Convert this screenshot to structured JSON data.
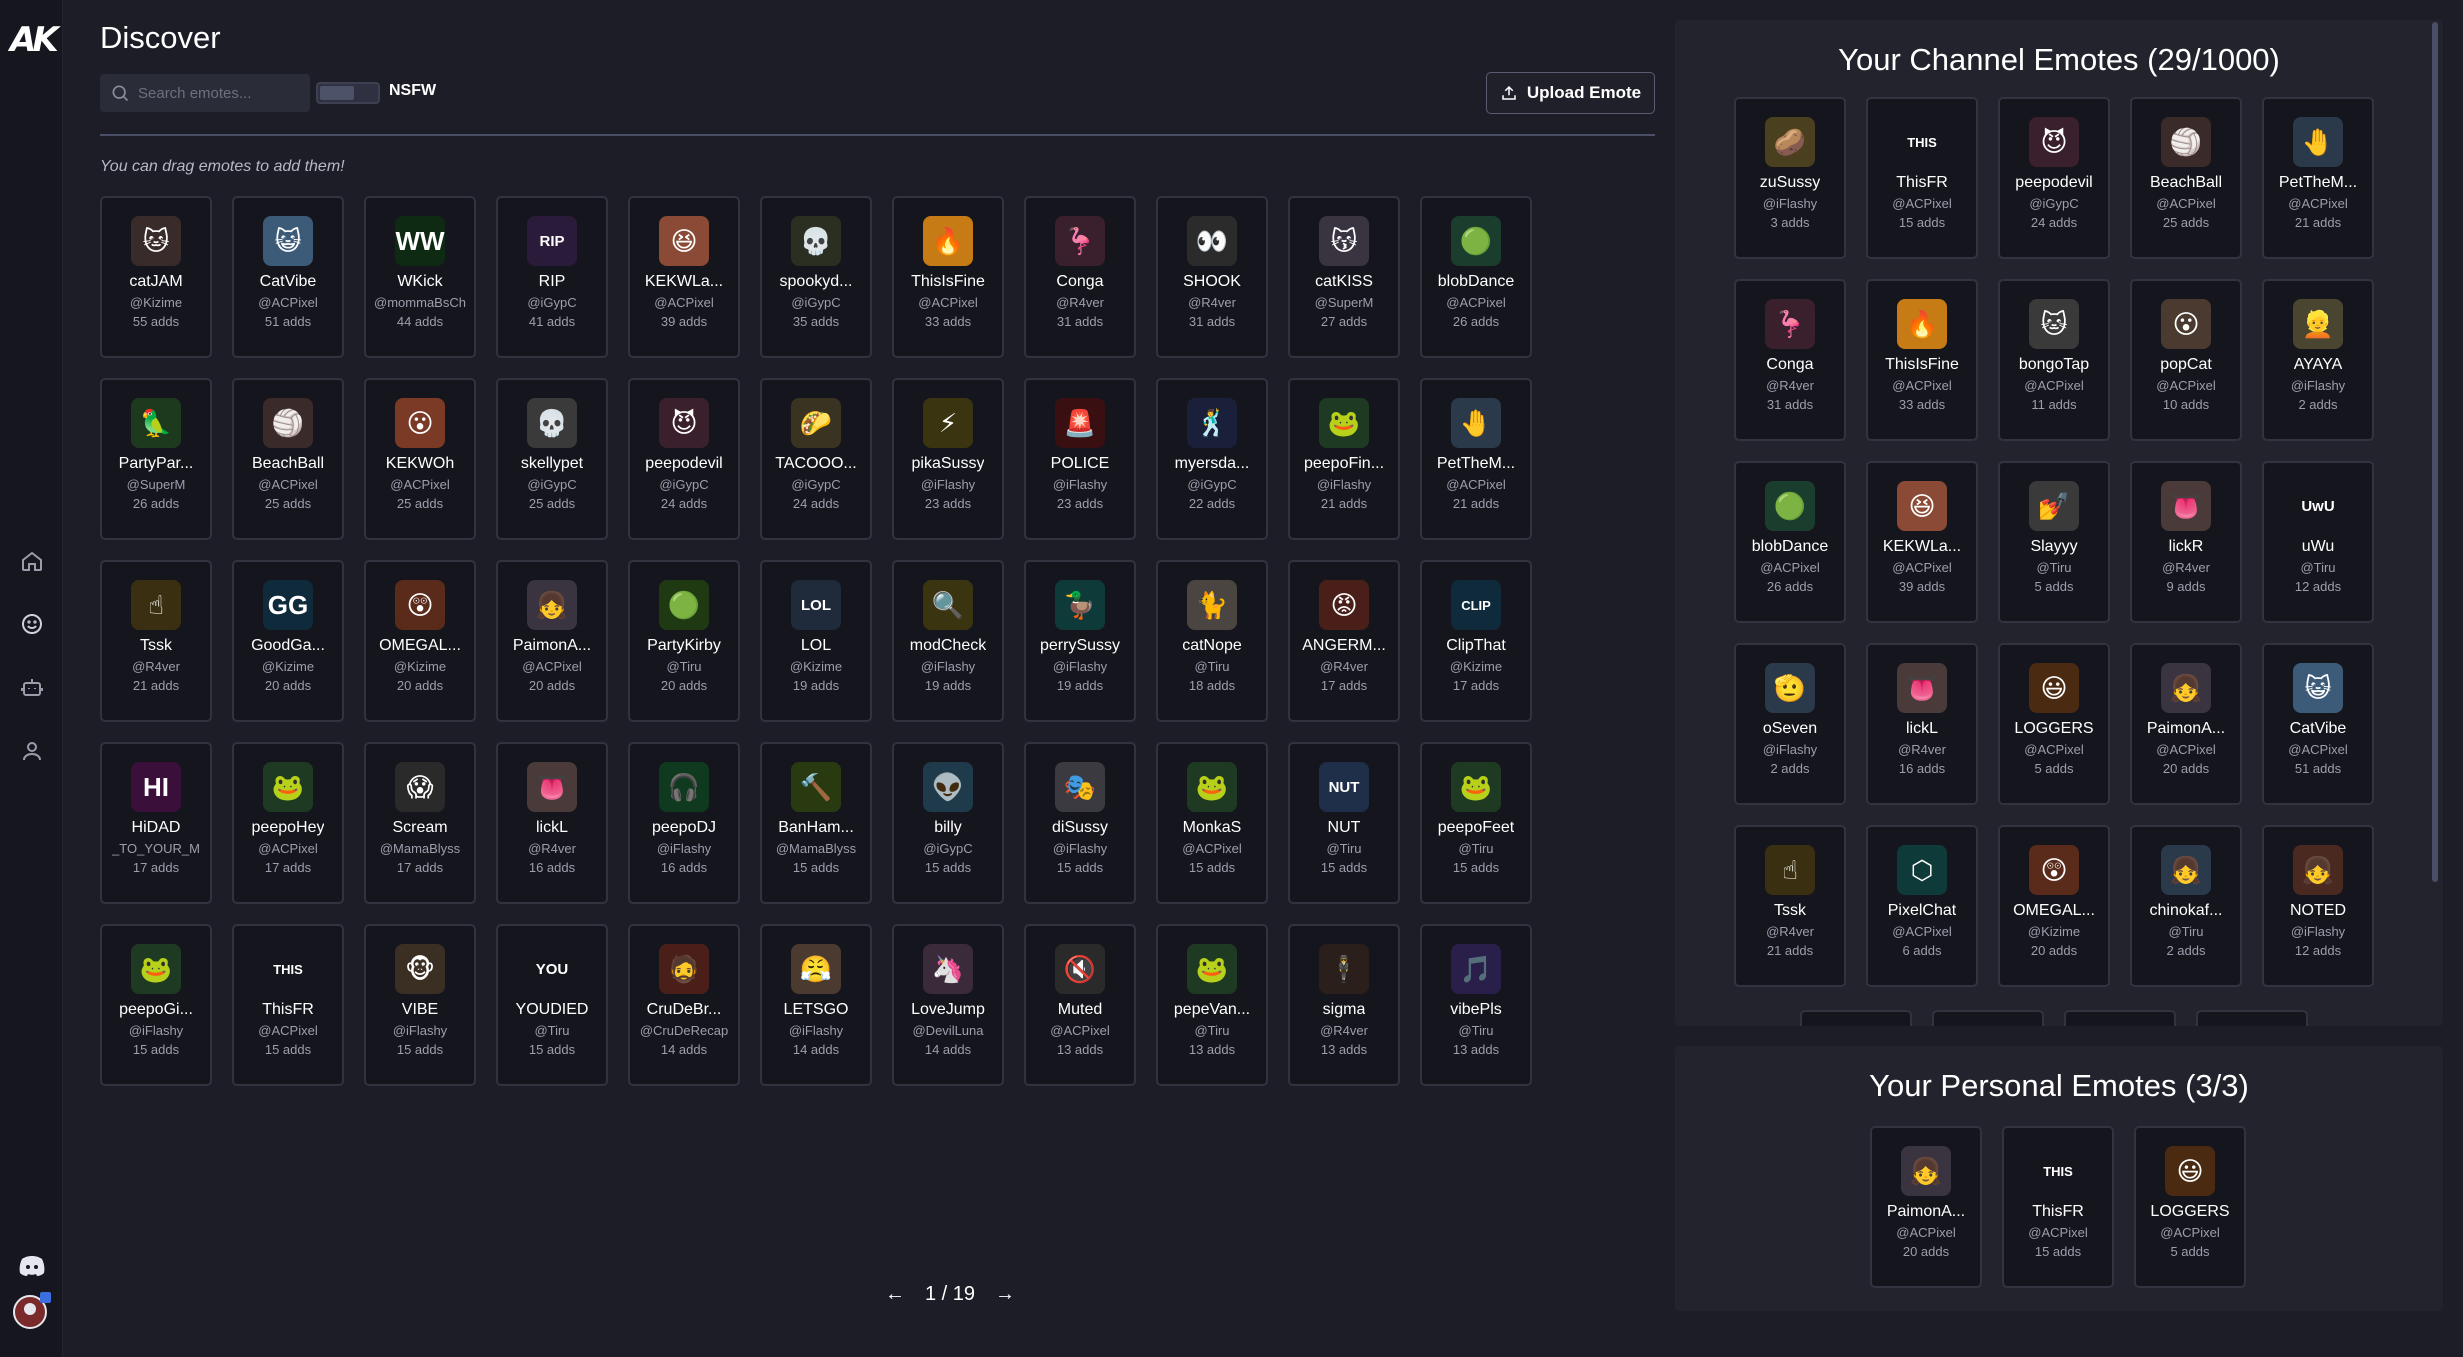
{
  "app": {
    "logo_text": "AK",
    "colors": {
      "background": "#1c1d26",
      "sidebar": "#16171e",
      "card": "#15161d",
      "panel": "#22232d",
      "divider": "#4b4f66"
    }
  },
  "sidebar": {
    "items": [
      {
        "name": "home",
        "icon": "home-icon"
      },
      {
        "name": "emotes",
        "icon": "smiley-icon"
      },
      {
        "name": "bot",
        "icon": "bot-icon"
      },
      {
        "name": "profile",
        "icon": "user-icon"
      }
    ],
    "bottom": [
      {
        "name": "discord",
        "icon": "discord-icon"
      },
      {
        "name": "avatar",
        "icon": "avatar-icon"
      }
    ]
  },
  "discover": {
    "title": "Discover",
    "search_placeholder": "Search emotes...",
    "nsfw_label": "NSFW",
    "nsfw_enabled": false,
    "upload_label": "Upload Emote",
    "hint": "You can drag emotes to add them!",
    "emotes": [
      {
        "name": "catJAM",
        "owner": "@Kizime",
        "adds": "55 adds",
        "glyph": "🐱",
        "color": "#3a2b2b"
      },
      {
        "name": "CatVibe",
        "owner": "@ACPixel",
        "adds": "51 adds",
        "glyph": "😺",
        "color": "#3b5b78"
      },
      {
        "name": "WKick",
        "owner": "@mommaBsCh",
        "adds": "44 adds",
        "glyph": "WW",
        "color": "#0f2a12"
      },
      {
        "name": "RIP",
        "owner": "@iGypC",
        "adds": "41 adds",
        "glyph": "RIP",
        "color": "#2b1b3a"
      },
      {
        "name": "KEKWLa...",
        "owner": "@ACPixel",
        "adds": "39 adds",
        "glyph": "😆",
        "color": "#8a4a35"
      },
      {
        "name": "spookyd...",
        "owner": "@iGypC",
        "adds": "35 adds",
        "glyph": "💀",
        "color": "#2b2f22"
      },
      {
        "name": "ThisIsFine",
        "owner": "@ACPixel",
        "adds": "33 adds",
        "glyph": "🔥",
        "color": "#c77b14"
      },
      {
        "name": "Conga",
        "owner": "@R4ver",
        "adds": "31 adds",
        "glyph": "🦩",
        "color": "#3a1f2c"
      },
      {
        "name": "SHOOK",
        "owner": "@R4ver",
        "adds": "31 adds",
        "glyph": "👀",
        "color": "#2b2b2b"
      },
      {
        "name": "catKISS",
        "owner": "@SuperM",
        "adds": "27 adds",
        "glyph": "😽",
        "color": "#3a3340"
      },
      {
        "name": "blobDance",
        "owner": "@ACPixel",
        "adds": "26 adds",
        "glyph": "🟢",
        "color": "#1a3d2e"
      },
      {
        "name": "PartyPar...",
        "owner": "@SuperM",
        "adds": "26 adds",
        "glyph": "🦜",
        "color": "#1e3a1e"
      },
      {
        "name": "BeachBall",
        "owner": "@ACPixel",
        "adds": "25 adds",
        "glyph": "🏐",
        "color": "#3a2a2a"
      },
      {
        "name": "KEKWOh",
        "owner": "@ACPixel",
        "adds": "25 adds",
        "glyph": "😮",
        "color": "#7a3a25"
      },
      {
        "name": "skellypet",
        "owner": "@iGypC",
        "adds": "25 adds",
        "glyph": "💀",
        "color": "#3a3a3a"
      },
      {
        "name": "peepodevil",
        "owner": "@iGypC",
        "adds": "24 adds",
        "glyph": "😈",
        "color": "#3a1f2c"
      },
      {
        "name": "TACOOO...",
        "owner": "@iGypC",
        "adds": "24 adds",
        "glyph": "🌮",
        "color": "#3a3322"
      },
      {
        "name": "pikaSussy",
        "owner": "@iFlashy",
        "adds": "23 adds",
        "glyph": "⚡",
        "color": "#3a3510"
      },
      {
        "name": "POLICE",
        "owner": "@iFlashy",
        "adds": "23 adds",
        "glyph": "🚨",
        "color": "#3a0f12"
      },
      {
        "name": "myersda...",
        "owner": "@iGypC",
        "adds": "22 adds",
        "glyph": "🕺",
        "color": "#1a1f3a"
      },
      {
        "name": "peepoFin...",
        "owner": "@iFlashy",
        "adds": "21 adds",
        "glyph": "🐸",
        "color": "#1f3a22"
      },
      {
        "name": "PetTheM...",
        "owner": "@ACPixel",
        "adds": "21 adds",
        "glyph": "🤚",
        "color": "#2b3a4a"
      },
      {
        "name": "Tssk",
        "owner": "@R4ver",
        "adds": "21 adds",
        "glyph": "☝",
        "color": "#3a2f10"
      },
      {
        "name": "GoodGa...",
        "owner": "@Kizime",
        "adds": "20 adds",
        "glyph": "GG",
        "color": "#0f2a3a"
      },
      {
        "name": "OMEGAL...",
        "owner": "@Kizime",
        "adds": "20 adds",
        "glyph": "😲",
        "color": "#5a2a1a"
      },
      {
        "name": "PaimonA...",
        "owner": "@ACPixel",
        "adds": "20 adds",
        "glyph": "👧",
        "color": "#3a3340"
      },
      {
        "name": "PartyKirby",
        "owner": "@Tiru",
        "adds": "20 adds",
        "glyph": "🟢",
        "color": "#1f3a12"
      },
      {
        "name": "LOL",
        "owner": "@Kizime",
        "adds": "19 adds",
        "glyph": "LOL",
        "color": "#1f2a3a"
      },
      {
        "name": "modCheck",
        "owner": "@iFlashy",
        "adds": "19 adds",
        "glyph": "🔍",
        "color": "#3a3510"
      },
      {
        "name": "perrySussy",
        "owner": "@iFlashy",
        "adds": "19 adds",
        "glyph": "🦆",
        "color": "#0f3a3a"
      },
      {
        "name": "catNope",
        "owner": "@Tiru",
        "adds": "18 adds",
        "glyph": "🐈",
        "color": "#4a4540"
      },
      {
        "name": "ANGERM...",
        "owner": "@R4ver",
        "adds": "17 adds",
        "glyph": "😡",
        "color": "#4a1f1a"
      },
      {
        "name": "ClipThat",
        "owner": "@Kizime",
        "adds": "17 adds",
        "glyph": "CLIP",
        "color": "#0f2a3a"
      },
      {
        "name": "HiDAD",
        "owner": "_TO_YOUR_M",
        "adds": "17 adds",
        "glyph": "HI",
        "color": "#3a0f3a"
      },
      {
        "name": "peepoHey",
        "owner": "@ACPixel",
        "adds": "17 adds",
        "glyph": "🐸",
        "color": "#1f3a22"
      },
      {
        "name": "Scream",
        "owner": "@MamaBlyss",
        "adds": "17 adds",
        "glyph": "😱",
        "color": "#2a2a2a"
      },
      {
        "name": "lickL",
        "owner": "@R4ver",
        "adds": "16 adds",
        "glyph": "👅",
        "color": "#4a3a3a"
      },
      {
        "name": "peepoDJ",
        "owner": "@iFlashy",
        "adds": "16 adds",
        "glyph": "🎧",
        "color": "#0f3a1f"
      },
      {
        "name": "BanHam...",
        "owner": "@MamaBlyss",
        "adds": "15 adds",
        "glyph": "🔨",
        "color": "#2a3a10"
      },
      {
        "name": "billy",
        "owner": "@iGypC",
        "adds": "15 adds",
        "glyph": "👽",
        "color": "#1f3a4a"
      },
      {
        "name": "diSussy",
        "owner": "@iFlashy",
        "adds": "15 adds",
        "glyph": "🎭",
        "color": "#3a3a40"
      },
      {
        "name": "MonkaS",
        "owner": "@ACPixel",
        "adds": "15 adds",
        "glyph": "🐸",
        "color": "#1f3a22"
      },
      {
        "name": "NUT",
        "owner": "@Tiru",
        "adds": "15 adds",
        "glyph": "NUT",
        "color": "#1f2f4a"
      },
      {
        "name": "peepoFeet",
        "owner": "@Tiru",
        "adds": "15 adds",
        "glyph": "🐸",
        "color": "#1f3a22"
      },
      {
        "name": "peepoGi...",
        "owner": "@iFlashy",
        "adds": "15 adds",
        "glyph": "🐸",
        "color": "#1f3a22"
      },
      {
        "name": "ThisFR",
        "owner": "@ACPixel",
        "adds": "15 adds",
        "glyph": "THIS",
        "color": "#15161d"
      },
      {
        "name": "VIBE",
        "owner": "@iFlashy",
        "adds": "15 adds",
        "glyph": "🐵",
        "color": "#3a2f22"
      },
      {
        "name": "YOUDIED",
        "owner": "@Tiru",
        "adds": "15 adds",
        "glyph": "YOU",
        "color": "#15161d"
      },
      {
        "name": "CruDeBr...",
        "owner": "@CruDeRecap",
        "adds": "14 adds",
        "glyph": "🧔",
        "color": "#4a1f1a"
      },
      {
        "name": "LETSGO",
        "owner": "@iFlashy",
        "adds": "14 adds",
        "glyph": "😤",
        "color": "#4a3a30"
      },
      {
        "name": "LoveJump",
        "owner": "@DevilLuna",
        "adds": "14 adds",
        "glyph": "🦄",
        "color": "#3a2a3a"
      },
      {
        "name": "Muted",
        "owner": "@ACPixel",
        "adds": "13 adds",
        "glyph": "🔇",
        "color": "#2a2a2a"
      },
      {
        "name": "pepeVan...",
        "owner": "@Tiru",
        "adds": "13 adds",
        "glyph": "🐸",
        "color": "#1f3a22"
      },
      {
        "name": "sigma",
        "owner": "@R4ver",
        "adds": "13 adds",
        "glyph": "🕴",
        "color": "#2a1f1a"
      },
      {
        "name": "vibePls",
        "owner": "@Tiru",
        "adds": "13 adds",
        "glyph": "🎵",
        "color": "#2a1f4a"
      }
    ],
    "pager": {
      "text": "1 / 19",
      "prev": "←",
      "next": "→"
    }
  },
  "channel": {
    "title": "Your Channel Emotes (29/1000)",
    "emotes": [
      {
        "name": "zuSussy",
        "owner": "@iFlashy",
        "adds": "3 adds",
        "glyph": "🥔",
        "color": "#4a4020"
      },
      {
        "name": "ThisFR",
        "owner": "@ACPixel",
        "adds": "15 adds",
        "glyph": "THIS",
        "color": "#15161d"
      },
      {
        "name": "peepodevil",
        "owner": "@iGypC",
        "adds": "24 adds",
        "glyph": "😈",
        "color": "#3a1f2c"
      },
      {
        "name": "BeachBall",
        "owner": "@ACPixel",
        "adds": "25 adds",
        "glyph": "🏐",
        "color": "#3a2a2a"
      },
      {
        "name": "PetTheM...",
        "owner": "@ACPixel",
        "adds": "21 adds",
        "glyph": "🤚",
        "color": "#2b3a4a"
      },
      {
        "name": "Conga",
        "owner": "@R4ver",
        "adds": "31 adds",
        "glyph": "🦩",
        "color": "#3a1f2c"
      },
      {
        "name": "ThisIsFine",
        "owner": "@ACPixel",
        "adds": "33 adds",
        "glyph": "🔥",
        "color": "#c77b14"
      },
      {
        "name": "bongoTap",
        "owner": "@ACPixel",
        "adds": "11 adds",
        "glyph": "🐱",
        "color": "#3a3a3a"
      },
      {
        "name": "popCat",
        "owner": "@ACPixel",
        "adds": "10 adds",
        "glyph": "😮",
        "color": "#4a3a30"
      },
      {
        "name": "AYAYA",
        "owner": "@iFlashy",
        "adds": "2 adds",
        "glyph": "👱",
        "color": "#4a4530"
      },
      {
        "name": "blobDance",
        "owner": "@ACPixel",
        "adds": "26 adds",
        "glyph": "🟢",
        "color": "#1a3d2e"
      },
      {
        "name": "KEKWLa...",
        "owner": "@ACPixel",
        "adds": "39 adds",
        "glyph": "😆",
        "color": "#8a4a35"
      },
      {
        "name": "Slayyy",
        "owner": "@Tiru",
        "adds": "5 adds",
        "glyph": "💅",
        "color": "#3a3a3a"
      },
      {
        "name": "lickR",
        "owner": "@R4ver",
        "adds": "9 adds",
        "glyph": "👅",
        "color": "#4a3a3a"
      },
      {
        "name": "uWu",
        "owner": "@Tiru",
        "adds": "12 adds",
        "glyph": "UwU",
        "color": "#15161d"
      },
      {
        "name": "oSeven",
        "owner": "@iFlashy",
        "adds": "2 adds",
        "glyph": "🫡",
        "color": "#2a3a4a"
      },
      {
        "name": "lickL",
        "owner": "@R4ver",
        "adds": "16 adds",
        "glyph": "👅",
        "color": "#4a3a3a"
      },
      {
        "name": "LOGGERS",
        "owner": "@ACPixel",
        "adds": "5 adds",
        "glyph": "😃",
        "color": "#4a2a10"
      },
      {
        "name": "PaimonA...",
        "owner": "@ACPixel",
        "adds": "20 adds",
        "glyph": "👧",
        "color": "#3a3340"
      },
      {
        "name": "CatVibe",
        "owner": "@ACPixel",
        "adds": "51 adds",
        "glyph": "😺",
        "color": "#3b5b78"
      },
      {
        "name": "Tssk",
        "owner": "@R4ver",
        "adds": "21 adds",
        "glyph": "☝",
        "color": "#3a2f10"
      },
      {
        "name": "PixelChat",
        "owner": "@ACPixel",
        "adds": "6 adds",
        "glyph": "⬡",
        "color": "#0f3a3a"
      },
      {
        "name": "OMEGAL...",
        "owner": "@Kizime",
        "adds": "20 adds",
        "glyph": "😲",
        "color": "#5a2a1a"
      },
      {
        "name": "chinokaf...",
        "owner": "@Tiru",
        "adds": "2 adds",
        "glyph": "👧",
        "color": "#2a3a4a"
      },
      {
        "name": "NOTED",
        "owner": "@iFlashy",
        "adds": "12 adds",
        "glyph": "👧",
        "color": "#4a2a20"
      }
    ]
  },
  "personal": {
    "title": "Your Personal Emotes (3/3)",
    "emotes": [
      {
        "name": "PaimonA...",
        "owner": "@ACPixel",
        "adds": "20 adds",
        "glyph": "👧",
        "color": "#3a3340"
      },
      {
        "name": "ThisFR",
        "owner": "@ACPixel",
        "adds": "15 adds",
        "glyph": "THIS",
        "color": "#15161d"
      },
      {
        "name": "LOGGERS",
        "owner": "@ACPixel",
        "adds": "5 adds",
        "glyph": "😃",
        "color": "#4a2a10"
      }
    ]
  }
}
